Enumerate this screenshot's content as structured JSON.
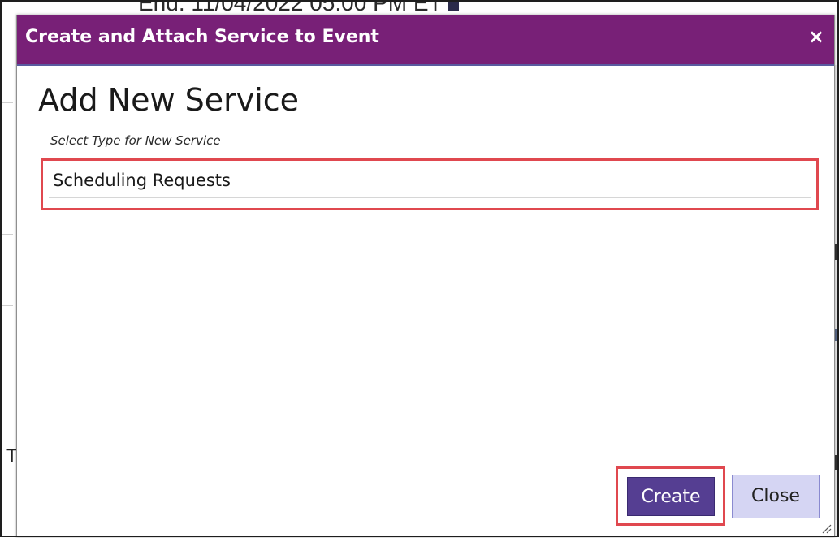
{
  "background": {
    "partial_text": "End:  11/04/2022 05:00 PM ET",
    "left_glyph": "T"
  },
  "dialog": {
    "title": "Create and Attach Service to Event",
    "close_icon": "×",
    "heading": "Add New Service",
    "select_caption": "Select Type for New Service",
    "service_type": {
      "selected_value": "Scheduling Requests"
    },
    "buttons": {
      "create_label": "Create",
      "close_label": "Close"
    }
  },
  "colors": {
    "titlebar": "#782077",
    "create_button": "#553e92",
    "close_button": "#d5d5f3",
    "highlight_outline": "#e0484f"
  },
  "icons": {
    "close": "close-icon",
    "resize": "resize-grip-icon"
  }
}
